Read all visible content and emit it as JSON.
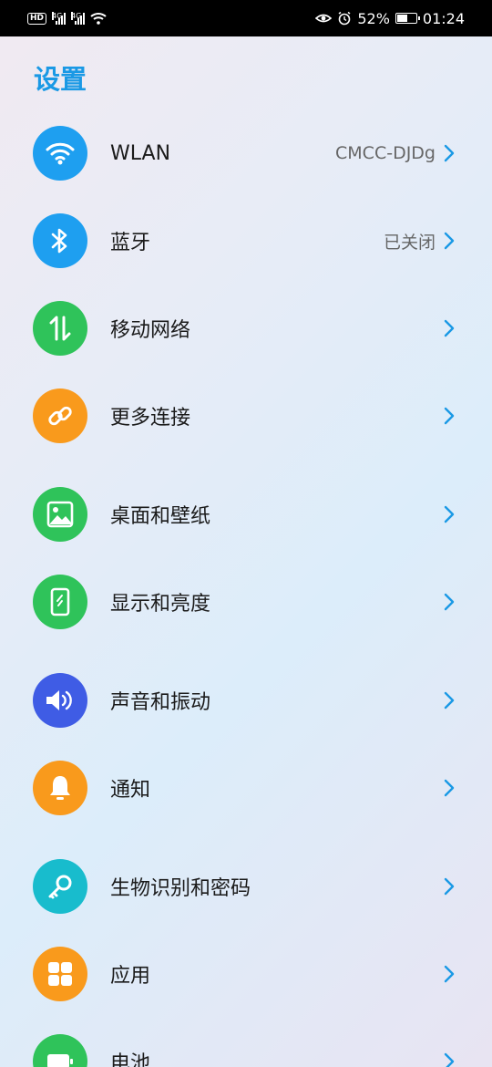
{
  "status_bar": {
    "hd_label": "HD",
    "network1": "4G",
    "network2": "4G",
    "battery_percent": "52%",
    "battery_level": 0.52,
    "time": "01:24"
  },
  "title": "设置",
  "items": [
    {
      "label": "WLAN",
      "value": "CMCC-DJDg",
      "icon": "wifi-icon",
      "color": "#1e9ff0"
    },
    {
      "label": "蓝牙",
      "value": "已关闭",
      "icon": "bluetooth-icon",
      "color": "#1e9ff0"
    },
    {
      "label": "移动网络",
      "value": "",
      "icon": "mobile-data-icon",
      "color": "#2fc35a"
    },
    {
      "label": "更多连接",
      "value": "",
      "icon": "link-icon",
      "color": "#f99a1c"
    },
    {
      "label": "桌面和壁纸",
      "value": "",
      "icon": "wallpaper-icon",
      "color": "#2fc35a"
    },
    {
      "label": "显示和亮度",
      "value": "",
      "icon": "phone-display-icon",
      "color": "#2fc35a"
    },
    {
      "label": "声音和振动",
      "value": "",
      "icon": "speaker-icon",
      "color": "#3f5ce5"
    },
    {
      "label": "通知",
      "value": "",
      "icon": "bell-icon",
      "color": "#f99a1c"
    },
    {
      "label": "生物识别和密码",
      "value": "",
      "icon": "key-icon",
      "color": "#18bccd"
    },
    {
      "label": "应用",
      "value": "",
      "icon": "apps-grid-icon",
      "color": "#f99a1c"
    },
    {
      "label": "电池",
      "value": "",
      "icon": "battery-icon",
      "color": "#2fc35a"
    }
  ],
  "accent_color": "#1a99e5",
  "chevron_color": "#1a99e5"
}
